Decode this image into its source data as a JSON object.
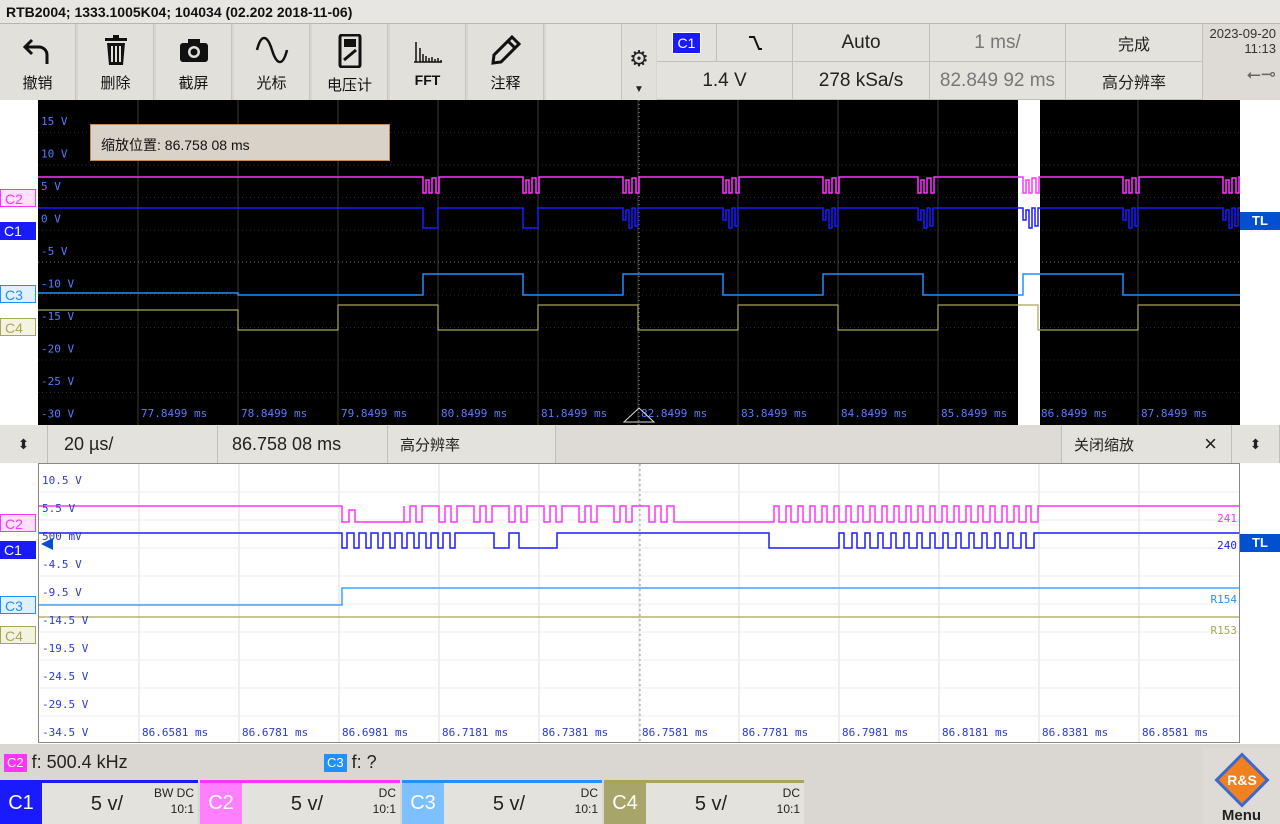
{
  "title": "RTB2004; 1333.1005K04; 104034 (02.202 2018-11-06)",
  "toolbar": {
    "undo": "撤销",
    "delete": "删除",
    "screenshot": "截屏",
    "cursor": "光标",
    "voltmeter": "电压计",
    "fft": "FFT",
    "annotate": "注释"
  },
  "trigger": {
    "source": "C1",
    "level": "1.4 V",
    "mode": "Auto",
    "sample_rate": "278 kSa/s",
    "timebase": "1 ms/",
    "position": "82.849 92 ms",
    "status": "完成",
    "acq_mode": "高分辨率"
  },
  "clock": {
    "date": "2023-09-20",
    "time": "11:13"
  },
  "colors": {
    "c1": "#1a1aff",
    "c2": "#ff33ff",
    "c3": "#1e90ff",
    "c4": "#a8a55a",
    "tl": "#0050d0"
  },
  "upper": {
    "zoom_box": "缩放位置: 86.758 08 ms",
    "y_labels": [
      "15 V",
      "10 V",
      "5 V",
      "0 V",
      "-5 V",
      "-10 V",
      "-15 V",
      "-20 V",
      "-25 V",
      "-30 V"
    ],
    "x_labels": [
      "77.8499 ms",
      "78.8499 ms",
      "79.8499 ms",
      "80.8499 ms",
      "81.8499 ms",
      "82.8499 ms",
      "83.8499 ms",
      "84.8499 ms",
      "85.8499 ms",
      "86.8499 ms",
      "87.8499 ms"
    ],
    "ch_labels": [
      "C2",
      "C1",
      "C3",
      "C4"
    ],
    "tl": "TL"
  },
  "zoom": {
    "timebase": "20 µs/",
    "position": "86.758 08 ms",
    "mode": "高分辨率",
    "close": "关闭缩放",
    "close_icon": "×"
  },
  "lower": {
    "y_labels": [
      "10.5 V",
      "5.5 V",
      "500 mV",
      "-4.5 V",
      "-9.5 V",
      "-14.5 V",
      "-19.5 V",
      "-24.5 V",
      "-29.5 V",
      "-34.5 V"
    ],
    "x_labels": [
      "86.6581 ms",
      "86.6781 ms",
      "86.6981 ms",
      "86.7181 ms",
      "86.7381 ms",
      "86.7581 ms",
      "86.7781 ms",
      "86.7981 ms",
      "86.8181 ms",
      "86.8381 ms",
      "86.8581 ms"
    ],
    "ch_labels": [
      "C2",
      "C1",
      "C3",
      "C4"
    ],
    "right_labels": [
      "241",
      "240",
      "R154",
      "R153"
    ],
    "tl": "TL"
  },
  "measurements": [
    {
      "ch": "C2",
      "text": "f: 500.4 kHz"
    },
    {
      "ch": "C3",
      "text": "f: ?"
    }
  ],
  "channels": [
    {
      "id": "C1",
      "scale": "5 v/",
      "coupling": "DC",
      "bw": "BW",
      "probe": "10:1"
    },
    {
      "id": "C2",
      "scale": "5 v/",
      "coupling": "DC",
      "probe": "10:1"
    },
    {
      "id": "C3",
      "scale": "5 v/",
      "coupling": "DC",
      "probe": "10:1"
    },
    {
      "id": "C4",
      "scale": "5 v/",
      "coupling": "DC",
      "probe": "10:1"
    }
  ],
  "menu": "Menu"
}
